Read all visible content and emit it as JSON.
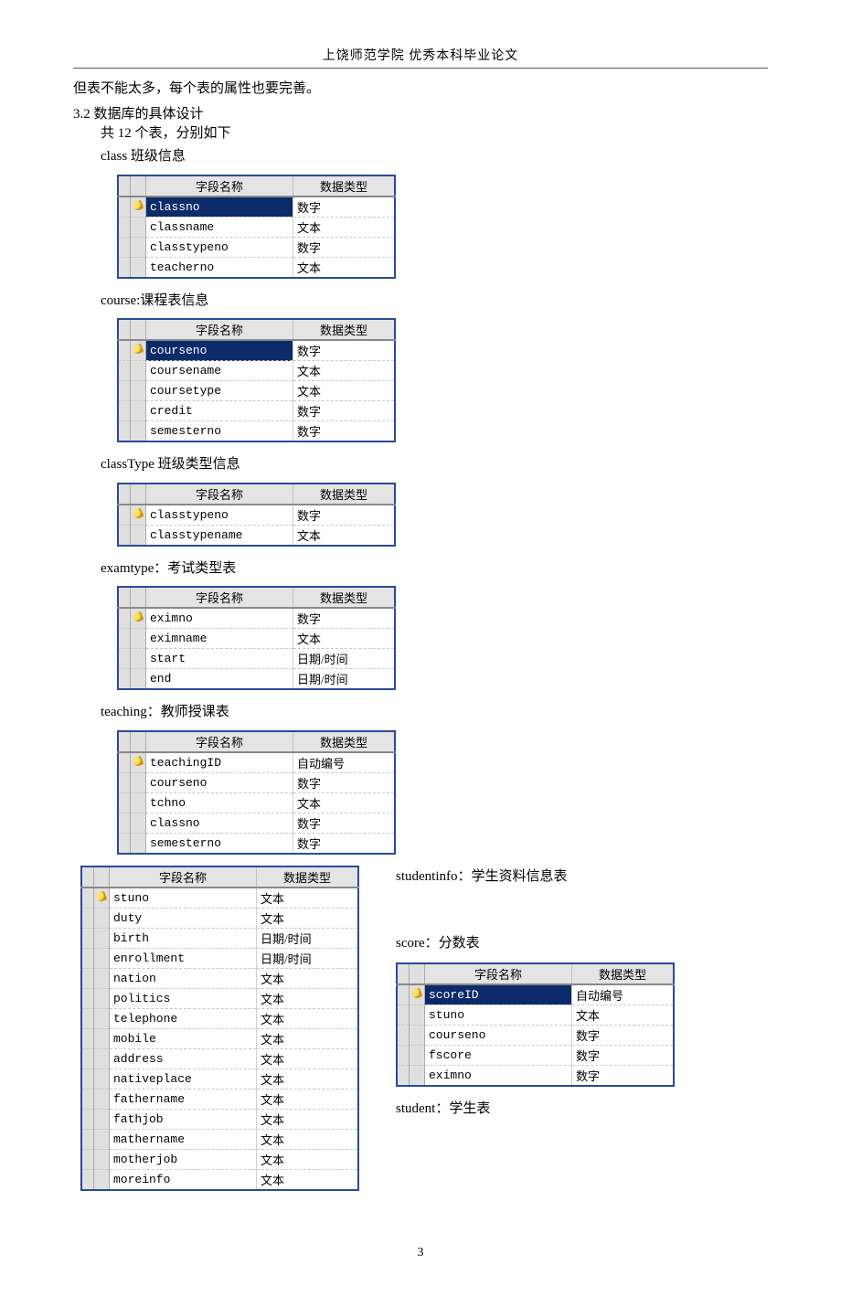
{
  "header": "上饶师范学院  优秀本科毕业论文",
  "intro_line": "但表不能太多，每个表的属性也要完善。",
  "section_3_2": "3.2 数据库的具体设计",
  "sub_line": "共 12 个表，分别如下",
  "th_field": "字段名称",
  "th_type": "数据类型",
  "tables": {
    "class": {
      "caption": "class 班级信息",
      "rows": [
        {
          "name": "classno",
          "type": "数字",
          "pk": true
        },
        {
          "name": "classname",
          "type": "文本"
        },
        {
          "name": "classtypeno",
          "type": "数字"
        },
        {
          "name": "teacherno",
          "type": "文本"
        }
      ]
    },
    "course": {
      "caption": "course:课程表信息",
      "rows": [
        {
          "name": "courseno",
          "type": "数字",
          "pk": true
        },
        {
          "name": "coursename",
          "type": "文本"
        },
        {
          "name": "coursetype",
          "type": "文本"
        },
        {
          "name": "credit",
          "type": "数字"
        },
        {
          "name": "semesterno",
          "type": "数字"
        }
      ]
    },
    "classType": {
      "caption": "classType 班级类型信息",
      "rows": [
        {
          "name": "classtypeno",
          "type": "数字",
          "pk": true
        },
        {
          "name": "classtypename",
          "type": "文本"
        }
      ]
    },
    "examtype": {
      "caption": "examtype：考试类型表",
      "rows": [
        {
          "name": "eximno",
          "type": "数字",
          "pk": true
        },
        {
          "name": "eximname",
          "type": "文本"
        },
        {
          "name": "start",
          "type": "日期/时间"
        },
        {
          "name": "end",
          "type": "日期/时间"
        }
      ]
    },
    "teaching": {
      "caption": "teaching：教师授课表",
      "rows": [
        {
          "name": "teachingID",
          "type": "自动编号",
          "pk": true
        },
        {
          "name": "courseno",
          "type": "数字"
        },
        {
          "name": "tchno",
          "type": "文本"
        },
        {
          "name": "classno",
          "type": "数字"
        },
        {
          "name": "semesterno",
          "type": "数字"
        }
      ]
    },
    "studentinfo": {
      "caption": "studentinfo：学生资料信息表",
      "rows": [
        {
          "name": "stuno",
          "type": "文本",
          "pk": true
        },
        {
          "name": "duty",
          "type": "文本"
        },
        {
          "name": "birth",
          "type": "日期/时间"
        },
        {
          "name": "enrollment",
          "type": "日期/时间"
        },
        {
          "name": "nation",
          "type": "文本"
        },
        {
          "name": "politics",
          "type": "文本"
        },
        {
          "name": "telephone",
          "type": "文本"
        },
        {
          "name": "mobile",
          "type": "文本"
        },
        {
          "name": "address",
          "type": "文本"
        },
        {
          "name": "nativeplace",
          "type": "文本"
        },
        {
          "name": "fathername",
          "type": "文本"
        },
        {
          "name": "fathjob",
          "type": "文本"
        },
        {
          "name": "mathername",
          "type": "文本"
        },
        {
          "name": "motherjob",
          "type": "文本"
        },
        {
          "name": "moreinfo",
          "type": "文本"
        }
      ]
    },
    "score": {
      "caption": "score：分数表",
      "rows": [
        {
          "name": "scoreID",
          "type": "自动编号",
          "pk": true
        },
        {
          "name": "stuno",
          "type": "文本"
        },
        {
          "name": "courseno",
          "type": "数字"
        },
        {
          "name": "fscore",
          "type": "数字"
        },
        {
          "name": "eximno",
          "type": "数字"
        }
      ]
    },
    "student": {
      "caption": "student：学生表"
    }
  },
  "page_number": "3"
}
